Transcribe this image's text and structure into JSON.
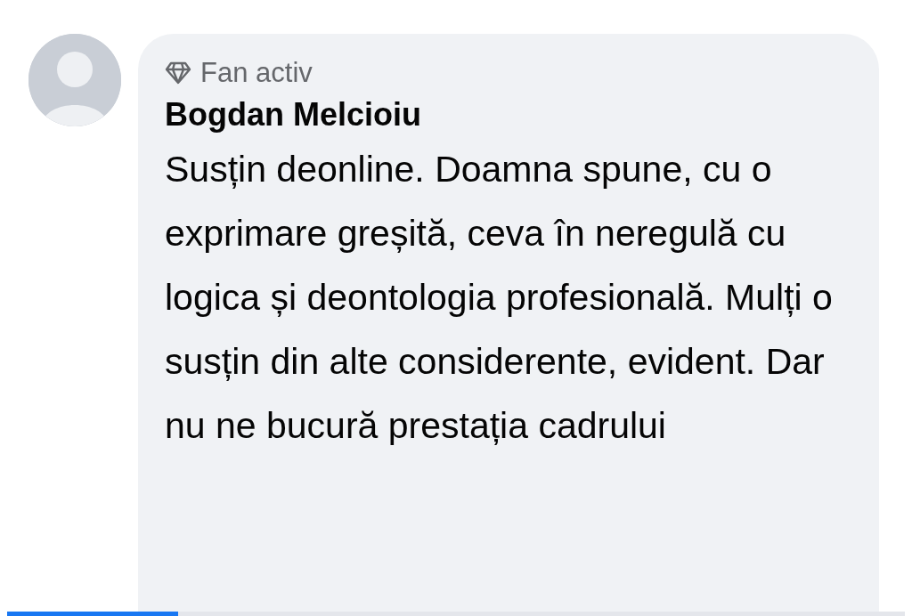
{
  "comment": {
    "badge": "Fan activ",
    "author": "Bogdan Melcioiu",
    "text": "Susțin deonline. Doamna spune, cu o exprimare greșită, ceva în neregulă cu logica și deontologia profesională. Mulți o susțin din alte considerente, evident. Dar nu ne bucură prestația cadrului"
  },
  "loading_bar": {
    "level": 0.19
  }
}
